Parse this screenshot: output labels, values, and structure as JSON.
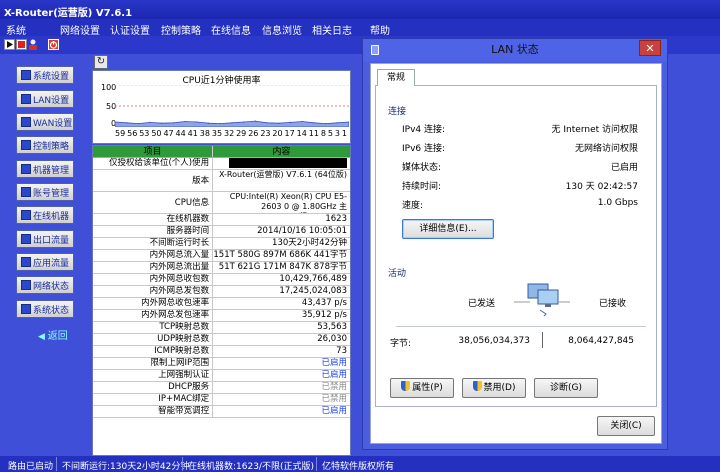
{
  "app": {
    "title": "X-Router(运营版) V7.6.1"
  },
  "menu": [
    "系统",
    "网络设置",
    "认证设置",
    "控制策略",
    "在线信息",
    "信息浏览",
    "相关日志",
    "帮助"
  ],
  "sidebar": {
    "items": [
      "系统设置",
      "LAN设置",
      "WAN设置",
      "控制策略",
      "机器管理",
      "账号管理",
      "在线机器",
      "出口流量",
      "应用流量",
      "网络状态",
      "系统状态"
    ],
    "back": "返回"
  },
  "chart_data": {
    "type": "area",
    "title": "CPU近1分钟使用率",
    "ylim": [
      0,
      100
    ],
    "yticks": [
      "100",
      "50",
      "0"
    ],
    "x": [
      "59",
      "56",
      "53",
      "50",
      "47",
      "44",
      "41",
      "38",
      "35",
      "32",
      "29",
      "26",
      "23",
      "20",
      "17",
      "14",
      "11",
      "8",
      "5",
      "3",
      "1"
    ],
    "values": [
      12,
      10,
      8,
      11,
      9,
      10,
      13,
      12,
      9,
      8,
      10,
      12,
      14,
      10,
      9,
      11,
      13,
      10,
      8,
      10,
      12
    ]
  },
  "table": {
    "headers": [
      "项目",
      "内容"
    ],
    "rows": [
      {
        "k": "仅授权给该单位(个人)使用",
        "v": "",
        "redacted": true
      },
      {
        "k": "版本",
        "v": "X-Router(运营版) V7.6.1 (64位版)",
        "tall": true
      },
      {
        "k": "CPU信息",
        "v": "CPU:Intel(R) Xeon(R) CPU E5-2603 0 @ 1.80GHz 主频:1800MHz",
        "tall": true
      },
      {
        "k": "在线机器数",
        "v": "1623"
      },
      {
        "k": "服务器时间",
        "v": "2014/10/16 10:05:01"
      },
      {
        "k": "不间断运行时长",
        "v": "130天2小时42分钟"
      },
      {
        "k": "内外网总流入量",
        "v": "151T 580G 897M 686K 441字节"
      },
      {
        "k": "内外网总流出量",
        "v": "51T 621G 171M 847K 878字节"
      },
      {
        "k": "内外网总收包数",
        "v": "10,429,766,489"
      },
      {
        "k": "内外网总发包数",
        "v": "17,245,024,083"
      },
      {
        "k": "内外网总收包速率",
        "v": "43,437 p/s"
      },
      {
        "k": "内外网总发包速率",
        "v": "35,912 p/s"
      },
      {
        "k": "TCP映射总数",
        "v": "53,563"
      },
      {
        "k": "UDP映射总数",
        "v": "26,030"
      },
      {
        "k": "ICMP映射总数",
        "v": "73"
      },
      {
        "k": "限制上网IP范围",
        "v": "已启用",
        "state": "on"
      },
      {
        "k": "上网强制认证",
        "v": "已启用",
        "state": "on"
      },
      {
        "k": "DHCP服务",
        "v": "已禁用",
        "state": "off"
      },
      {
        "k": "IP+MAC绑定",
        "v": "已禁用",
        "state": "off"
      },
      {
        "k": "智能带宽调控",
        "v": "已启用",
        "state": "on"
      }
    ]
  },
  "statusbar": [
    "路由已启动",
    "不间断运行:130天2小时42分钟",
    "在线机器数:1623/不限(正式版)",
    "亿特软件版权所有"
  ],
  "dialog": {
    "title": "LAN 状态",
    "tab": "常规",
    "connection_header": "连接",
    "fields": [
      {
        "label": "IPv4 连接:",
        "value": "无 Internet 访问权限"
      },
      {
        "label": "IPv6 连接:",
        "value": "无网络访问权限"
      },
      {
        "label": "媒体状态:",
        "value": "已启用"
      },
      {
        "label": "持续时间:",
        "value": "130 天 02:42:57"
      },
      {
        "label": "速度:",
        "value": "1.0 Gbps"
      }
    ],
    "details_button": "详细信息(E)...",
    "activity_header": "活动",
    "sent_label": "已发送",
    "received_label": "已接收",
    "bytes_label": "字节:",
    "bytes_sent": "38,056,034,373",
    "bytes_received": "8,064,427,845",
    "buttons": {
      "properties": "属性(P)",
      "disable": "禁用(D)",
      "diagnose": "诊断(G)",
      "close": "关闭(C)"
    }
  }
}
